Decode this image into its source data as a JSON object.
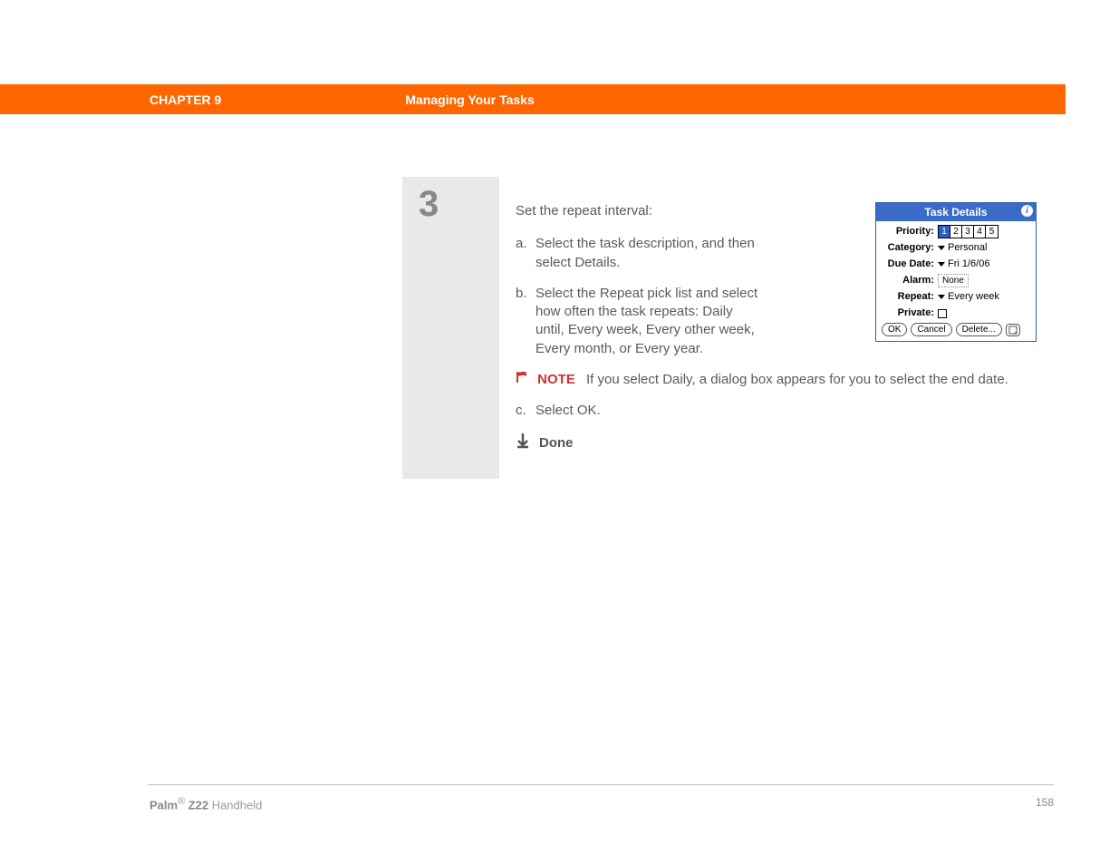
{
  "header": {
    "chapter": "CHAPTER 9",
    "title": "Managing Your Tasks"
  },
  "step": {
    "number": "3",
    "intro": "Set the repeat interval:",
    "items": [
      {
        "marker": "a.",
        "text": "Select the task description, and then select Details."
      },
      {
        "marker": "b.",
        "text": "Select the Repeat pick list and select how often the task repeats: Daily until, Every week, Every other week, Every month, or Every year."
      }
    ],
    "note_label": "NOTE",
    "note_text": "If you select Daily, a dialog box appears for you to select the end date.",
    "item_c": {
      "marker": "c.",
      "text": "Select OK."
    },
    "done": "Done"
  },
  "screenshot": {
    "title": "Task Details",
    "info": "i",
    "priority_label": "Priority:",
    "priorities": [
      "1",
      "2",
      "3",
      "4",
      "5"
    ],
    "category_label": "Category:",
    "category_value": "Personal",
    "duedate_label": "Due Date:",
    "duedate_value": "Fri 1/6/06",
    "alarm_label": "Alarm:",
    "alarm_value": "None",
    "repeat_label": "Repeat:",
    "repeat_value": "Every week",
    "private_label": "Private:",
    "ok": "OK",
    "cancel": "Cancel",
    "delete": "Delete..."
  },
  "footer": {
    "brand_bold": "Palm",
    "brand_reg": "®",
    "brand_model": " Z22",
    "brand_rest": " Handheld",
    "page": "158"
  }
}
